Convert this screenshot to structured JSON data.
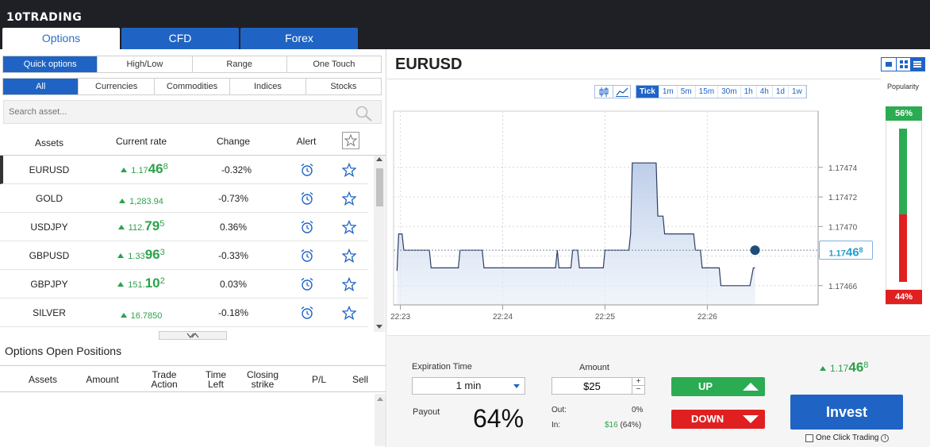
{
  "brand": {
    "logo_text": "10TRADING"
  },
  "main_tabs": [
    {
      "label": "Options",
      "active": true
    },
    {
      "label": "CFD",
      "active": false
    },
    {
      "label": "Forex",
      "active": false
    }
  ],
  "option_types": [
    "Quick options",
    "High/Low",
    "Range",
    "One Touch"
  ],
  "categories": [
    "All",
    "Currencies",
    "Commodities",
    "Indices",
    "Stocks"
  ],
  "search": {
    "placeholder": "Search asset..."
  },
  "asset_table": {
    "headers": {
      "assets": "Assets",
      "rate": "Current rate",
      "change": "Change",
      "alert": "Alert"
    },
    "rows": [
      {
        "asset": "EURUSD",
        "rate_prefix": "1.17",
        "rate_big": "46",
        "rate_sup": "8",
        "change": "-0.32%"
      },
      {
        "asset": "GOLD",
        "rate_prefix": "1,283.94",
        "rate_big": "",
        "rate_sup": "",
        "change": "-0.73%"
      },
      {
        "asset": "USDJPY",
        "rate_prefix": "112.",
        "rate_big": "79",
        "rate_sup": "5",
        "change": "0.36%"
      },
      {
        "asset": "GBPUSD",
        "rate_prefix": "1.33",
        "rate_big": "96",
        "rate_sup": "3",
        "change": "-0.33%"
      },
      {
        "asset": "GBPJPY",
        "rate_prefix": "151.",
        "rate_big": "10",
        "rate_sup": "2",
        "change": "0.03%"
      },
      {
        "asset": "SILVER",
        "rate_prefix": "16.7850",
        "rate_big": "",
        "rate_sup": "",
        "change": "-0.18%"
      }
    ]
  },
  "open_positions": {
    "title": "Options Open Positions",
    "headers": {
      "assets": "Assets",
      "amount": "Amount",
      "trade_action": "Trade Action",
      "time_left": "Time Left",
      "closing_strike": "Closing strike",
      "pl": "P/L",
      "sell": "Sell"
    }
  },
  "chart_panel": {
    "pair": "EURUSD",
    "popularity_label": "Popularity",
    "timeframes": [
      "Tick",
      "1m",
      "5m",
      "15m",
      "30m",
      "1h",
      "4h",
      "1d",
      "1w"
    ],
    "selected_timeframe": "Tick",
    "current_rate_prefix": "1.17",
    "current_rate_big": "46",
    "current_rate_sup": "8"
  },
  "popularity": {
    "up_label": "56%",
    "down_label": "44%",
    "up_pct": 56,
    "down_pct": 44
  },
  "chart_data": {
    "type": "area",
    "title": "",
    "xlabel": "",
    "ylabel": "",
    "x_ticks": [
      "22:23",
      "22:24",
      "22:25",
      "22:26"
    ],
    "y_ticks": [
      "1.17474",
      "1.17472",
      "1.17470",
      "1.17468",
      "1.17466"
    ],
    "ylim": [
      1.174647,
      1.174778
    ],
    "grid": true,
    "current_value": 1.174684,
    "series": [
      {
        "points": [
          [
            "22:22:58",
            1.17467
          ],
          [
            "22:22:59",
            1.174695
          ],
          [
            "22:23:01",
            1.174695
          ],
          [
            "22:23:02",
            1.174684
          ],
          [
            "22:23:17",
            1.174684
          ],
          [
            "22:23:18",
            1.174672
          ],
          [
            "22:23:34",
            1.174672
          ],
          [
            "22:23:35",
            1.174684
          ],
          [
            "22:23:48",
            1.174684
          ],
          [
            "22:23:49",
            1.174672
          ],
          [
            "22:24:31",
            1.174672
          ],
          [
            "22:24:32",
            1.174684
          ],
          [
            "22:24:33",
            1.174672
          ],
          [
            "22:24:40",
            1.174672
          ],
          [
            "22:24:41",
            1.174684
          ],
          [
            "22:24:44",
            1.174684
          ],
          [
            "22:24:45",
            1.174672
          ],
          [
            "22:24:59",
            1.174672
          ],
          [
            "22:25:00",
            1.174684
          ],
          [
            "22:25:14",
            1.174684
          ],
          [
            "22:25:15",
            1.174695
          ],
          [
            "22:25:16",
            1.174743
          ],
          [
            "22:25:30",
            1.174743
          ],
          [
            "22:25:31",
            1.174707
          ],
          [
            "22:25:34",
            1.174707
          ],
          [
            "22:25:35",
            1.174695
          ],
          [
            "22:25:52",
            1.174695
          ],
          [
            "22:25:53",
            1.174684
          ],
          [
            "22:25:56",
            1.174684
          ],
          [
            "22:25:57",
            1.174672
          ],
          [
            "22:26:07",
            1.174672
          ],
          [
            "22:26:08",
            1.17466
          ],
          [
            "22:26:25",
            1.17466
          ],
          [
            "22:26:27",
            1.174672
          ],
          [
            "22:26:28",
            1.174672
          ]
        ]
      }
    ]
  },
  "trade": {
    "expiration_label": "Expiration Time",
    "expiration_value": "1 min",
    "payout_label": "Payout",
    "payout_value": "64%",
    "amount_label": "Amount",
    "amount_value": "$25",
    "out_label": "Out:",
    "out_value": "0%",
    "in_label": "In:",
    "in_value": "$16",
    "in_pct": "(64%)",
    "up_label": "UP",
    "down_label": "DOWN",
    "rate_prefix": "1.17",
    "rate_big": "46",
    "rate_sup": "8",
    "invest_label": "Invest",
    "one_click_label": "One Click Trading"
  },
  "colors": {
    "accent": "#1f64c4",
    "up": "#2bab52",
    "down": "#e02020",
    "topbar": "#1f2026"
  }
}
